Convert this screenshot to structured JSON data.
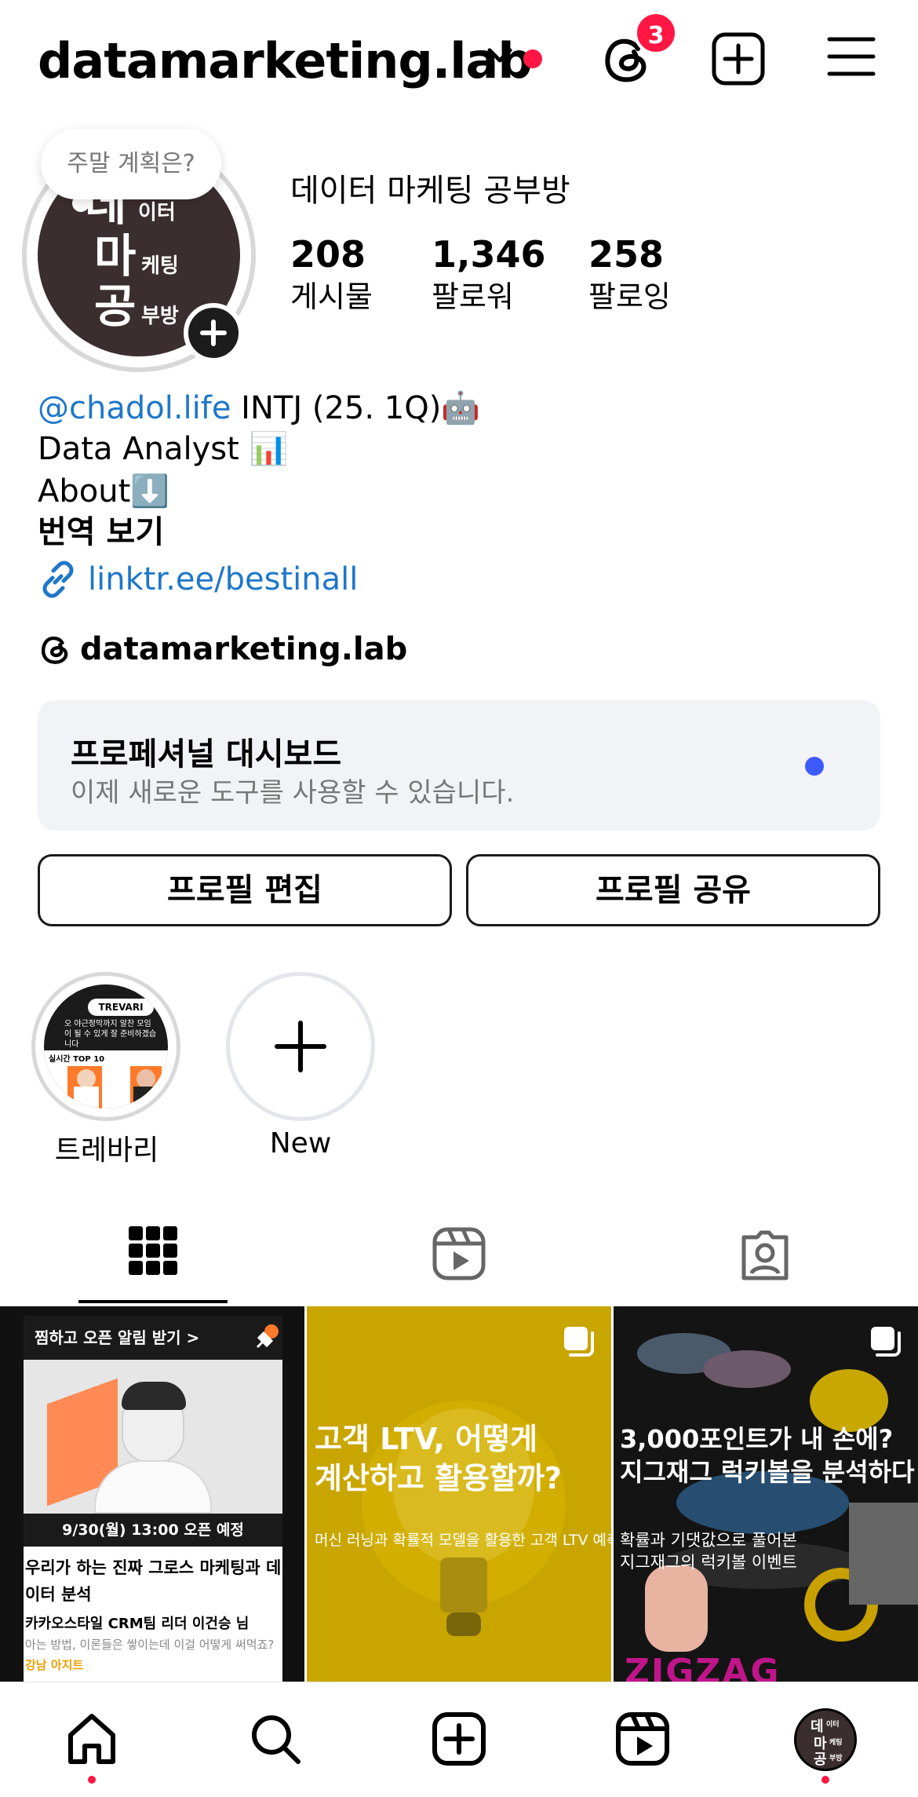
{
  "header": {
    "username": "datamarketing.lab",
    "notification_count": "3"
  },
  "profile": {
    "note": "주말 계획은?",
    "avatar_text": {
      "big1": "데",
      "small1": "이터",
      "big2": "마",
      "small2": "케팅",
      "big3": "공",
      "small3": "부방"
    },
    "display_name": "데이터 마케팅 공부방",
    "stats": [
      {
        "value": "208",
        "label": "게시물"
      },
      {
        "value": "1,346",
        "label": "팔로워"
      },
      {
        "value": "258",
        "label": "팔로잉"
      }
    ],
    "bio": {
      "mention": "@chadol.life",
      "line1_rest": " INTJ (25. 1Q)🤖",
      "line2": "Data Analyst 📊",
      "line3": "About⬇️",
      "translate": "번역 보기",
      "link": "linktr.ee/bestinall",
      "threads_handle": "datamarketing.lab"
    }
  },
  "dashboard": {
    "title": "프로페셔널 대시보드",
    "subtitle": "이제 새로운 도구를 사용할 수 있습니다."
  },
  "buttons": {
    "edit": "프로필 편집",
    "share": "프로필 공유"
  },
  "highlights": [
    {
      "label": "트레바리"
    },
    {
      "label": "New"
    }
  ],
  "highlight_thumb": {
    "brand": "TREVARI",
    "caption": "오 야근정막까지 알찬 모임이 될 수 있게 잘 준비하겠습니다",
    "rank_title": "실시간 TOP 10"
  },
  "posts": [
    {
      "banner": "찜하고 오픈 알림 받기 >",
      "date": "9/30(월) 13:00 오픈 예정",
      "title": "우리가 하는 진짜 그로스 마케팅과 데이터 분석",
      "speaker": "카카오스타일 CRM팀 리더 이건승 님",
      "desc": "아는 방법, 이론들은 쌓이는데 이걸 어떻게 써먹죠?",
      "location": "강남 아지트"
    },
    {
      "title_line1": "고객 LTV, 어떻게",
      "title_line2": "계산하고 활용할까?",
      "subtitle": "머신 러닝과 확률적 모델을 활용한 고객 LTV 예측"
    },
    {
      "title_line1": "3,000포인트가 내 손에?",
      "title_line2": "지그재그 럭키볼을 분석하다",
      "sub_line1": "확률과 기댓값으로 풀어본",
      "sub_line2": "지그재그의 럭키볼 이벤트",
      "watermark": "ZIGZAG"
    }
  ],
  "colors": {
    "accent_blue": "#1f77c9",
    "notification_red": "#ff1744",
    "dashboard_dot": "#3d5afe"
  }
}
